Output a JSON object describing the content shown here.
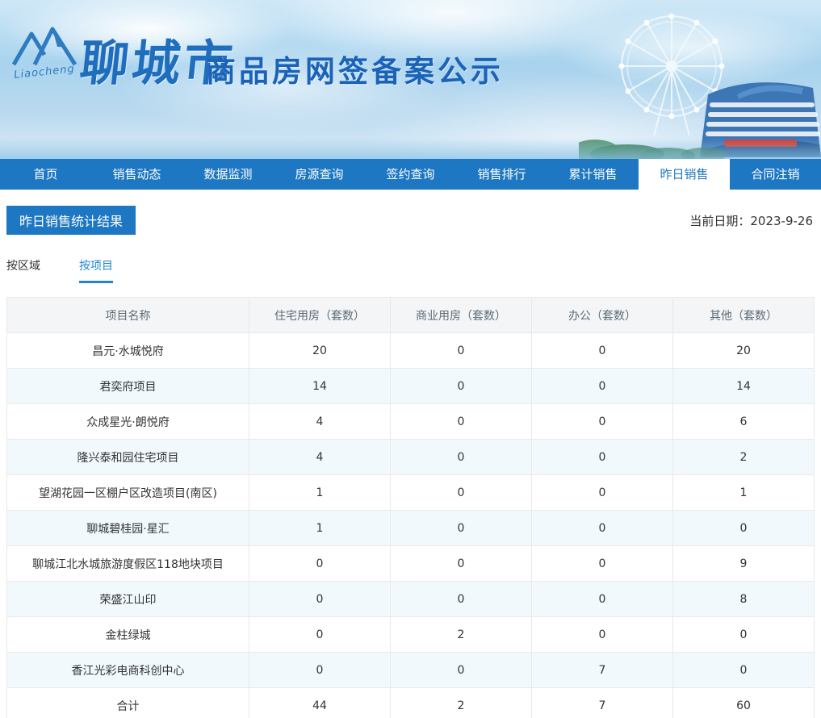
{
  "banner": {
    "logo_text": "聊城市",
    "logo_script": "Liaocheng",
    "title": "商品房网签备案公示"
  },
  "nav": {
    "items": [
      {
        "label": "首页",
        "active": false
      },
      {
        "label": "销售动态",
        "active": false
      },
      {
        "label": "数据监测",
        "active": false
      },
      {
        "label": "房源查询",
        "active": false
      },
      {
        "label": "签约查询",
        "active": false
      },
      {
        "label": "销售排行",
        "active": false
      },
      {
        "label": "累计销售",
        "active": false
      },
      {
        "label": "昨日销售",
        "active": true
      },
      {
        "label": "合同注销",
        "active": false
      }
    ]
  },
  "page": {
    "title": "昨日销售统计结果",
    "date_label": "当前日期：2023-9-26"
  },
  "tabs": [
    {
      "label": "按区域",
      "active": false
    },
    {
      "label": "按项目",
      "active": true
    }
  ],
  "table": {
    "headers": [
      "项目名称",
      "住宅用房（套数）",
      "商业用房（套数）",
      "办公（套数）",
      "其他（套数）"
    ],
    "rows": [
      [
        "昌元·水城悦府",
        "20",
        "0",
        "0",
        "20"
      ],
      [
        "君奕府项目",
        "14",
        "0",
        "0",
        "14"
      ],
      [
        "众成星光·朗悦府",
        "4",
        "0",
        "0",
        "6"
      ],
      [
        "隆兴泰和园住宅项目",
        "4",
        "0",
        "0",
        "2"
      ],
      [
        "望湖花园一区棚户区改造项目(南区)",
        "1",
        "0",
        "0",
        "1"
      ],
      [
        "聊城碧桂园·星汇",
        "1",
        "0",
        "0",
        "0"
      ],
      [
        "聊城江北水城旅游度假区118地块项目",
        "0",
        "0",
        "0",
        "9"
      ],
      [
        "荣盛江山印",
        "0",
        "0",
        "0",
        "8"
      ],
      [
        "金柱绿城",
        "0",
        "2",
        "0",
        "0"
      ],
      [
        "香江光彩电商科创中心",
        "0",
        "0",
        "7",
        "0"
      ],
      [
        "合计",
        "44",
        "2",
        "7",
        "60"
      ]
    ]
  },
  "colors": {
    "nav_blue": "#1e77c2",
    "active_tab_blue": "#1e86d0",
    "alt_row": "#f1f9fd",
    "header_row": "#f3f5f7"
  }
}
